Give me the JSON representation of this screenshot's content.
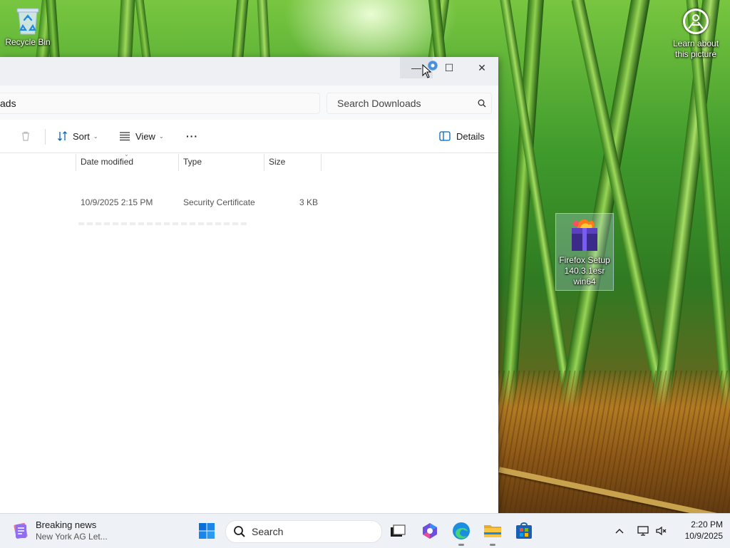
{
  "desktop": {
    "icons": {
      "recycle_bin": "Recycle Bin",
      "learn_picture": "Learn about this picture",
      "firefox_setup": "Firefox Setup 140.3.1esr win64"
    }
  },
  "explorer": {
    "address_partial": "ads",
    "search_placeholder": "Search Downloads",
    "toolbar": {
      "sort_label": "Sort",
      "view_label": "View",
      "more_label": "···",
      "details_label": "Details"
    },
    "columns": {
      "date_modified": "Date modified",
      "type": "Type",
      "size": "Size"
    },
    "rows": [
      {
        "date_modified": "10/9/2025 2:15 PM",
        "type": "Security Certificate",
        "size": "3 KB"
      }
    ],
    "caption": {
      "minimize": "—",
      "maximize": "☐",
      "close": "✕"
    }
  },
  "taskbar": {
    "news": {
      "headline": "Breaking news",
      "subtext": "New York AG Let..."
    },
    "search_label": "Search",
    "clock": {
      "time": "2:20 PM",
      "date": "10/9/2025"
    },
    "apps": [
      "task-view",
      "copilot",
      "edge",
      "file-explorer",
      "store"
    ]
  },
  "colors": {
    "accent": "#0067c0",
    "window_bg": "#ffffff",
    "titlebar_bg": "#eef0f3",
    "taskbar_bg": "#eef1f5"
  }
}
